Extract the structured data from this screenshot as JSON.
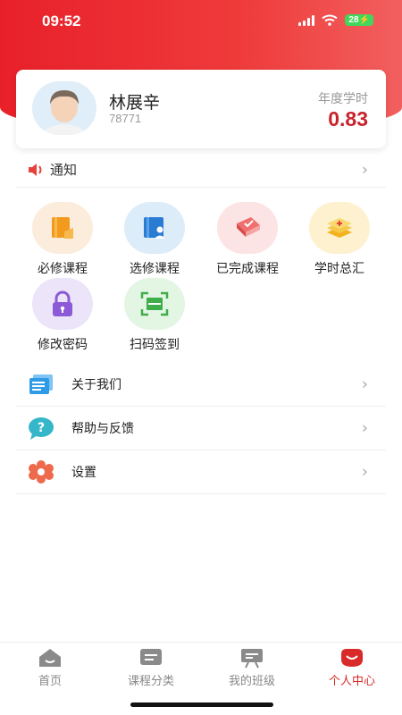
{
  "status_bar": {
    "time": "09:52",
    "battery": "28"
  },
  "profile": {
    "name": "林展辛",
    "id": "78771",
    "hours_label": "年度学时",
    "hours_value": "0.83"
  },
  "notice": {
    "label": "通知"
  },
  "grid": [
    {
      "label": "必修课程",
      "icon": "required-course-icon",
      "bg": "#fcecdc"
    },
    {
      "label": "选修课程",
      "icon": "elective-course-icon",
      "bg": "#dcecf8"
    },
    {
      "label": "已完成课程",
      "icon": "completed-course-icon",
      "bg": "#fde4e4"
    },
    {
      "label": "学时总汇",
      "icon": "hours-summary-icon",
      "bg": "#fdf1cf"
    },
    {
      "label": "修改密码",
      "icon": "lock-icon",
      "bg": "#ece4f8"
    },
    {
      "label": "扫码签到",
      "icon": "scan-icon",
      "bg": "#e3f5e3"
    }
  ],
  "menu": [
    {
      "label": "关于我们",
      "icon": "about-icon"
    },
    {
      "label": "帮助与反馈",
      "icon": "help-icon"
    },
    {
      "label": "设置",
      "icon": "settings-icon"
    }
  ],
  "tabs": [
    {
      "label": "首页",
      "icon": "home-icon"
    },
    {
      "label": "课程分类",
      "icon": "course-category-icon"
    },
    {
      "label": "我的班级",
      "icon": "my-class-icon"
    },
    {
      "label": "个人中心",
      "icon": "profile-icon",
      "active": true
    }
  ],
  "colors": {
    "brand_red": "#e8202a",
    "hours_red": "#c8232c"
  }
}
